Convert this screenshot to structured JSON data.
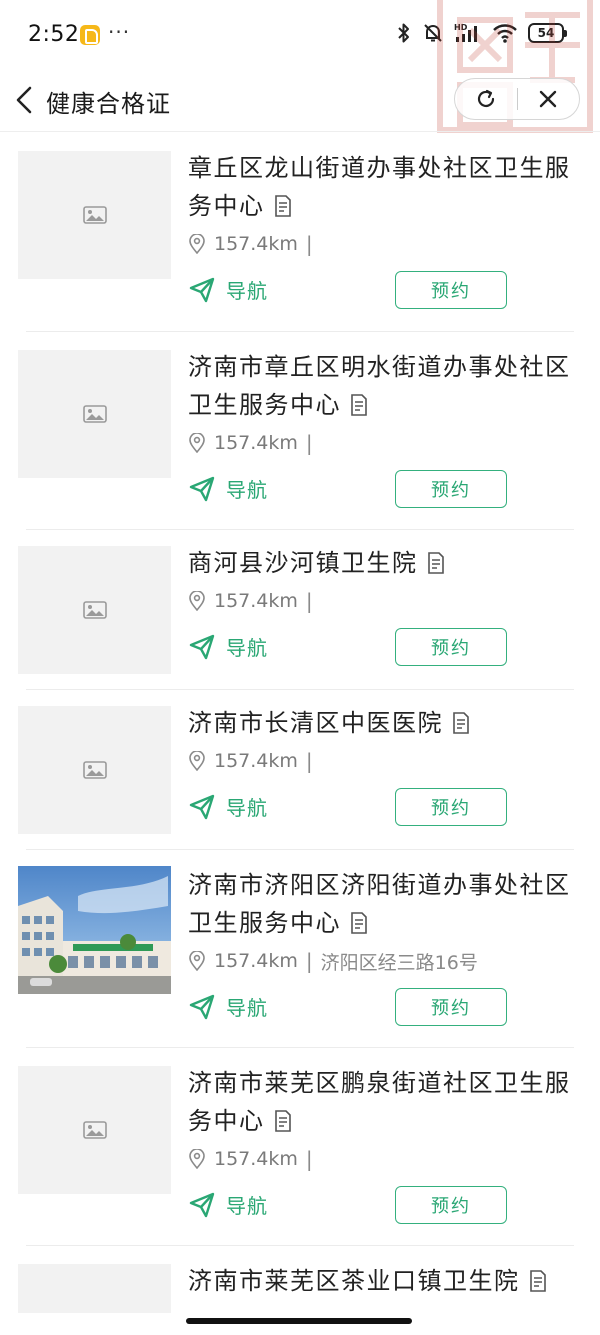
{
  "status": {
    "time": "2:52",
    "dots": "···",
    "battery": "54"
  },
  "header": {
    "title": "健康合格证"
  },
  "items": [
    {
      "name": "章丘区龙山街道办事处社区卫生服务中心",
      "distance": "157.4km",
      "separator": "|",
      "address": "",
      "nav_label": "导航",
      "book_label": "预约",
      "has_photo": false
    },
    {
      "name": "济南市章丘区明水街道办事处社区卫生服务中心",
      "distance": "157.4km",
      "separator": "|",
      "address": "",
      "nav_label": "导航",
      "book_label": "预约",
      "has_photo": false
    },
    {
      "name": "商河县沙河镇卫生院",
      "distance": "157.4km",
      "separator": "|",
      "address": "",
      "nav_label": "导航",
      "book_label": "预约",
      "has_photo": false
    },
    {
      "name": "济南市长清区中医医院",
      "distance": "157.4km",
      "separator": "|",
      "address": "",
      "nav_label": "导航",
      "book_label": "预约",
      "has_photo": false
    },
    {
      "name": "济南市济阳区济阳街道办事处社区卫生服务中心",
      "distance": "157.4km",
      "separator": "|",
      "address": "济阳区经三路16号",
      "nav_label": "导航",
      "book_label": "预约",
      "has_photo": true
    },
    {
      "name": "济南市莱芜区鹏泉街道社区卫生服务中心",
      "distance": "157.4km",
      "separator": "|",
      "address": "",
      "nav_label": "导航",
      "book_label": "预约",
      "has_photo": false
    },
    {
      "name": "济南市莱芜区茶业口镇卫生院",
      "distance": "",
      "separator": "",
      "address": "",
      "nav_label": "",
      "book_label": "",
      "has_photo": false
    }
  ],
  "colors": {
    "accent": "#2aa774",
    "text": "#222222",
    "meta": "#7a7a7a",
    "placeholder_bg": "#f2f2f2"
  }
}
